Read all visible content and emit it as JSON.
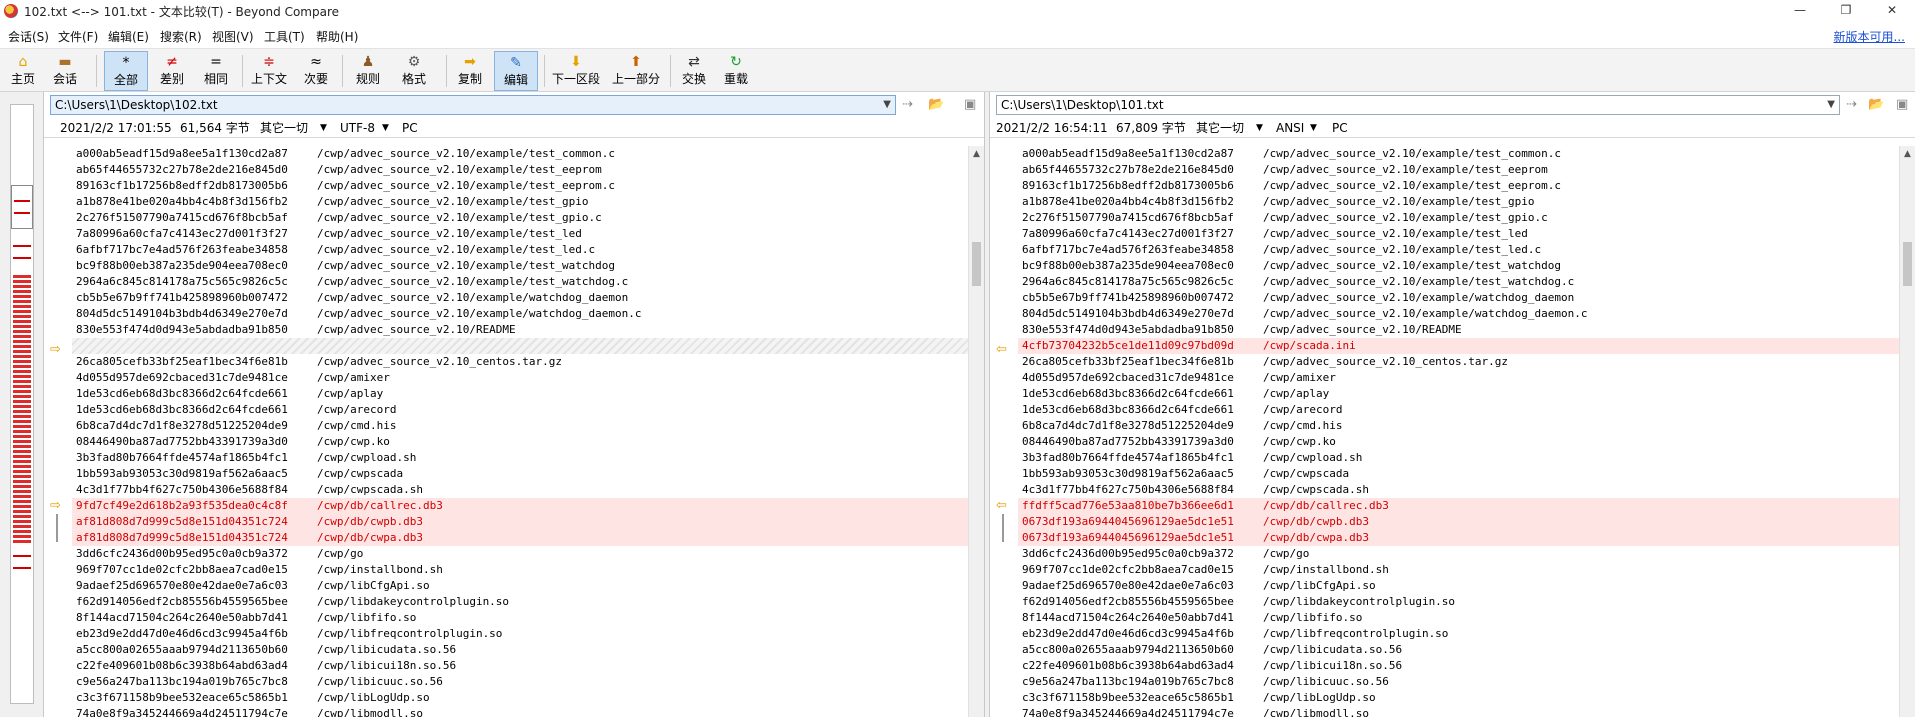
{
  "window": {
    "title": "102.txt <--> 101.txt - 文本比较(T) - Beyond Compare",
    "controls": [
      "—",
      "❐",
      "✕"
    ]
  },
  "menu": {
    "items": [
      "会话(S)",
      "文件(F)",
      "编辑(E)",
      "搜索(R)",
      "视图(V)",
      "工具(T)",
      "帮助(H)"
    ],
    "new_version": "新版本可用..."
  },
  "toolbar": {
    "home": "主页",
    "session": "会话",
    "all": "全部",
    "diffs": "差别",
    "same": "相同",
    "context": "上下文",
    "minor": "次要",
    "rules": "规则",
    "format": "格式",
    "copy": "复制",
    "edit": "编辑",
    "next_section": "下一区段",
    "prev_part": "上一部分",
    "swap": "交换",
    "reload": "重载"
  },
  "left": {
    "path": "C:\\Users\\1\\Desktop\\102.txt",
    "date": "2021/2/2 17:01:55",
    "size": "61,564 字节",
    "filter": "其它一切",
    "encoding": "UTF-8",
    "lineend": "PC",
    "lines": [
      {
        "hash": "a000ab5eadf15d9a8ee5a1f130cd2a87",
        "path": "/cwp/advec_source_v2.10/example/test_common.c"
      },
      {
        "hash": "ab65f44655732c27b78e2de216e845d0",
        "path": "/cwp/advec_source_v2.10/example/test_eeprom"
      },
      {
        "hash": "89163cf1b17256b8edff2db8173005b6",
        "path": "/cwp/advec_source_v2.10/example/test_eeprom.c"
      },
      {
        "hash": "a1b878e41be020a4bb4c4b8f3d156fb2",
        "path": "/cwp/advec_source_v2.10/example/test_gpio"
      },
      {
        "hash": "2c276f51507790a7415cd676f8bcb5af",
        "path": "/cwp/advec_source_v2.10/example/test_gpio.c"
      },
      {
        "hash": "7a80996a60cfa7c4143ec27d001f3f27",
        "path": "/cwp/advec_source_v2.10/example/test_led"
      },
      {
        "hash": "6afbf717bc7e4ad576f263feabe34858",
        "path": "/cwp/advec_source_v2.10/example/test_led.c"
      },
      {
        "hash": "bc9f88b00eb387a235de904eea708ec0",
        "path": "/cwp/advec_source_v2.10/example/test_watchdog"
      },
      {
        "hash": "2964a6c845c814178a75c565c9826c5c",
        "path": "/cwp/advec_source_v2.10/example/test_watchdog.c"
      },
      {
        "hash": "cb5b5e67b9ff741b425898960b007472",
        "path": "/cwp/advec_source_v2.10/example/watchdog_daemon"
      },
      {
        "hash": "804d5dc5149104b3bdb4d6349e270e7d",
        "path": "/cwp/advec_source_v2.10/example/watchdog_daemon.c"
      },
      {
        "hash": "830e553f474d0d943e5abdadba91b850",
        "path": "/cwp/advec_source_v2.10/README"
      },
      {
        "hash": "",
        "path": "",
        "kind": "missing"
      },
      {
        "hash": "26ca805cefb33bf25eaf1bec34f6e81b",
        "path": "/cwp/advec_source_v2.10_centos.tar.gz"
      },
      {
        "hash": "4d055d957de692cbaced31c7de9481ce",
        "path": "/cwp/amixer"
      },
      {
        "hash": "1de53cd6eb68d3bc8366d2c64fcde661",
        "path": "/cwp/aplay"
      },
      {
        "hash": "1de53cd6eb68d3bc8366d2c64fcde661",
        "path": "/cwp/arecord"
      },
      {
        "hash": "6b8ca7d4dc7d1f8e3278d51225204de9",
        "path": "/cwp/cmd.his"
      },
      {
        "hash": "08446490ba87ad7752bb43391739a3d0",
        "path": "/cwp/cwp.ko"
      },
      {
        "hash": "3b3fad80b7664ffde4574af1865b4fc1",
        "path": "/cwp/cwpload.sh"
      },
      {
        "hash": "1bb593ab93053c30d9819af562a6aac5",
        "path": "/cwp/cwpscada"
      },
      {
        "hash": "4c3d1f77bb4f627c750b4306e5688f84",
        "path": "/cwp/cwpscada.sh"
      },
      {
        "hash": "9fd7cf49e2d618b2a93f535dea0c4c8f",
        "path": "/cwp/db/callrec.db3",
        "kind": "diff"
      },
      {
        "hash": "af81d808d7d999c5d8e151d04351c724",
        "path": "/cwp/db/cwpb.db3",
        "kind": "diff"
      },
      {
        "hash": "af81d808d7d999c5d8e151d04351c724",
        "path": "/cwp/db/cwpa.db3",
        "kind": "diff"
      },
      {
        "hash": "3dd6cfc2436d00b95ed95c0a0cb9a372",
        "path": "/cwp/go"
      },
      {
        "hash": "969f707cc1de02cfc2bb8aea7cad0e15",
        "path": "/cwp/installbond.sh"
      },
      {
        "hash": "9adaef25d696570e80e42dae0e7a6c03",
        "path": "/cwp/libCfgApi.so"
      },
      {
        "hash": "f62d914056edf2cb85556b4559565bee",
        "path": "/cwp/libdakeycontrolplugin.so"
      },
      {
        "hash": "8f144acd71504c264c2640e50abb7d41",
        "path": "/cwp/libfifo.so"
      },
      {
        "hash": "eb23d9e2dd47d0e46d6cd3c9945a4f6b",
        "path": "/cwp/libfreqcontrolplugin.so"
      },
      {
        "hash": "a5cc800a02655aaab9794d2113650b60",
        "path": "/cwp/libicudata.so.56"
      },
      {
        "hash": "c22fe409601b08b6c3938b64abd63ad4",
        "path": "/cwp/libicui18n.so.56"
      },
      {
        "hash": "c9e56a247ba113bc194a019b765c7bc8",
        "path": "/cwp/libicuuc.so.56"
      },
      {
        "hash": "c3c3f671158b9bee532eace65c5865b1",
        "path": "/cwp/libLogUdp.so"
      },
      {
        "hash": "74a0e8f9a345244669a4d24511794c7e",
        "path": "/cwp/libmodll.so"
      }
    ]
  },
  "right": {
    "path": "C:\\Users\\1\\Desktop\\101.txt",
    "date": "2021/2/2 16:54:11",
    "size": "67,809 字节",
    "filter": "其它一切",
    "encoding": "ANSI",
    "lineend": "PC",
    "lines": [
      {
        "hash": "a000ab5eadf15d9a8ee5a1f130cd2a87",
        "path": "/cwp/advec_source_v2.10/example/test_common.c"
      },
      {
        "hash": "ab65f44655732c27b78e2de216e845d0",
        "path": "/cwp/advec_source_v2.10/example/test_eeprom"
      },
      {
        "hash": "89163cf1b17256b8edff2db8173005b6",
        "path": "/cwp/advec_source_v2.10/example/test_eeprom.c"
      },
      {
        "hash": "a1b878e41be020a4bb4c4b8f3d156fb2",
        "path": "/cwp/advec_source_v2.10/example/test_gpio"
      },
      {
        "hash": "2c276f51507790a7415cd676f8bcb5af",
        "path": "/cwp/advec_source_v2.10/example/test_gpio.c"
      },
      {
        "hash": "7a80996a60cfa7c4143ec27d001f3f27",
        "path": "/cwp/advec_source_v2.10/example/test_led"
      },
      {
        "hash": "6afbf717bc7e4ad576f263feabe34858",
        "path": "/cwp/advec_source_v2.10/example/test_led.c"
      },
      {
        "hash": "bc9f88b00eb387a235de904eea708ec0",
        "path": "/cwp/advec_source_v2.10/example/test_watchdog"
      },
      {
        "hash": "2964a6c845c814178a75c565c9826c5c",
        "path": "/cwp/advec_source_v2.10/example/test_watchdog.c"
      },
      {
        "hash": "cb5b5e67b9ff741b425898960b007472",
        "path": "/cwp/advec_source_v2.10/example/watchdog_daemon"
      },
      {
        "hash": "804d5dc5149104b3bdb4d6349e270e7d",
        "path": "/cwp/advec_source_v2.10/example/watchdog_daemon.c"
      },
      {
        "hash": "830e553f474d0d943e5abdadba91b850",
        "path": "/cwp/advec_source_v2.10/README"
      },
      {
        "hash": "4cfb73704232b5ce1de11d09c97bd09d",
        "path": "/cwp/scada.ini",
        "kind": "diff"
      },
      {
        "hash": "26ca805cefb33bf25eaf1bec34f6e81b",
        "path": "/cwp/advec_source_v2.10_centos.tar.gz"
      },
      {
        "hash": "4d055d957de692cbaced31c7de9481ce",
        "path": "/cwp/amixer"
      },
      {
        "hash": "1de53cd6eb68d3bc8366d2c64fcde661",
        "path": "/cwp/aplay"
      },
      {
        "hash": "1de53cd6eb68d3bc8366d2c64fcde661",
        "path": "/cwp/arecord"
      },
      {
        "hash": "6b8ca7d4dc7d1f8e3278d51225204de9",
        "path": "/cwp/cmd.his"
      },
      {
        "hash": "08446490ba87ad7752bb43391739a3d0",
        "path": "/cwp/cwp.ko"
      },
      {
        "hash": "3b3fad80b7664ffde4574af1865b4fc1",
        "path": "/cwp/cwpload.sh"
      },
      {
        "hash": "1bb593ab93053c30d9819af562a6aac5",
        "path": "/cwp/cwpscada"
      },
      {
        "hash": "4c3d1f77bb4f627c750b4306e5688f84",
        "path": "/cwp/cwpscada.sh"
      },
      {
        "hash": "ffdff5cad776e53aa810be7b366ee6d1",
        "path": "/cwp/db/callrec.db3",
        "kind": "diff"
      },
      {
        "hash": "0673df193a6944045696129ae5dc1e51",
        "path": "/cwp/db/cwpb.db3",
        "kind": "diff"
      },
      {
        "hash": "0673df193a6944045696129ae5dc1e51",
        "path": "/cwp/db/cwpa.db3",
        "kind": "diff"
      },
      {
        "hash": "3dd6cfc2436d00b95ed95c0a0cb9a372",
        "path": "/cwp/go"
      },
      {
        "hash": "969f707cc1de02cfc2bb8aea7cad0e15",
        "path": "/cwp/installbond.sh"
      },
      {
        "hash": "9adaef25d696570e80e42dae0e7a6c03",
        "path": "/cwp/libCfgApi.so"
      },
      {
        "hash": "f62d914056edf2cb85556b4559565bee",
        "path": "/cwp/libdakeycontrolplugin.so"
      },
      {
        "hash": "8f144acd71504c264c2640e50abb7d41",
        "path": "/cwp/libfifo.so"
      },
      {
        "hash": "eb23d9e2dd47d0e46d6cd3c9945a4f6b",
        "path": "/cwp/libfreqcontrolplugin.so"
      },
      {
        "hash": "a5cc800a02655aaab9794d2113650b60",
        "path": "/cwp/libicudata.so.56"
      },
      {
        "hash": "c22fe409601b08b6c3938b64abd63ad4",
        "path": "/cwp/libicui18n.so.56"
      },
      {
        "hash": "c9e56a247ba113bc194a019b765c7bc8",
        "path": "/cwp/libicuuc.so.56"
      },
      {
        "hash": "c3c3f671158b9bee532eace65c5865b1",
        "path": "/cwp/libLogUdp.so"
      },
      {
        "hash": "74a0e8f9a345244669a4d24511794c7e",
        "path": "/cwp/libmodll.so"
      }
    ]
  },
  "colors": {
    "diff_text": "#d10000",
    "diff_bg": "#ffe4e4",
    "accent": "#1a4fd6"
  }
}
